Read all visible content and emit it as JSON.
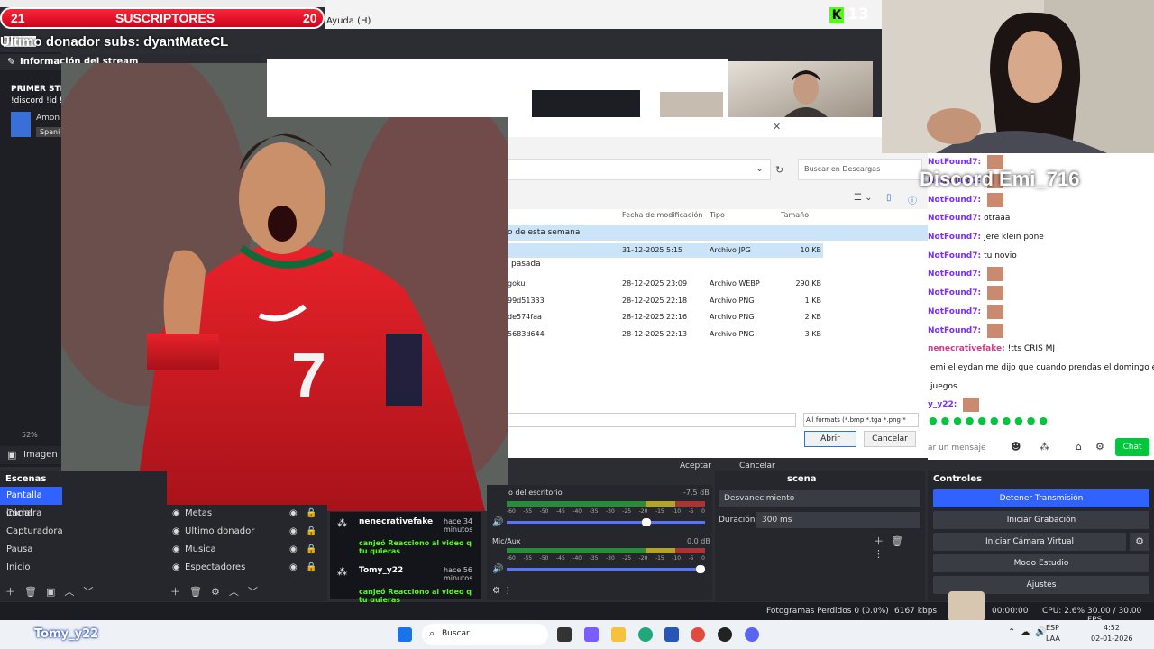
{
  "overlay": {
    "subs_left": "21",
    "subs_label": "SUSCRIPTORES",
    "subs_right": "20",
    "kick_count": "13",
    "donor_text": "Ultimo donador subs: dyantMateCL",
    "discord_text": "Discord Emi_716"
  },
  "obs": {
    "menu_help": "Ayuda (H)",
    "info_tab": "info",
    "stream_info_header": "Información del stream",
    "stream_title": "PRIMER STR",
    "stream_sub": "!discord !id !",
    "game": "Amon",
    "lang": "Spani",
    "zoom": "52%",
    "image_label": "Imagen",
    "scenes_header": "Escenas",
    "scenes": [
      "Pantalla inicial",
      "Camara",
      "Capturadora",
      "Pausa",
      "Inicio"
    ],
    "sources": [
      "Metas",
      "Ultimo donador",
      "Musica",
      "Espectadores"
    ],
    "events": [
      {
        "user": "nenecrativefake",
        "time": "hace 34 minutos",
        "text": "canjeó Reacciono al video q tu quieras"
      },
      {
        "user": "Tomy_y22",
        "time": "hace 56 minutos",
        "text": "canjeó Reacciono al video q tu quieras"
      }
    ],
    "mixer": {
      "track1": "o del escritorio",
      "track1_db": "-7.5 dB",
      "track2": "Mic/Aux",
      "track2_db": "0.0 dB",
      "ticks": [
        "-60",
        "-55",
        "-50",
        "-45",
        "-40",
        "-35",
        "-30",
        "-25",
        "-20",
        "-15",
        "-10",
        "-5",
        "0"
      ]
    },
    "transitions": {
      "header": "scena",
      "type": "Desvanecimiento",
      "duration_label": "Duración",
      "duration_value": "300 ms"
    },
    "controls": {
      "header": "Controles",
      "stop": "Detener Transmisión",
      "record": "Iniciar Grabación",
      "vcam": "Iniciar Cámara Virtual",
      "studio": "Modo Estudio",
      "settings": "Ajustes"
    },
    "status": {
      "dropped": "Fotogramas Perdidos 0 (0.0%)",
      "kbps": "6167 kbps",
      "rec": "00:00:00",
      "cpu": "CPU: 2.6%",
      "fps": "30.00 / 30.00 FPS"
    },
    "dialog_buttons": {
      "ok": "Aceptar",
      "cancel": "Cancelar"
    }
  },
  "file_dialog": {
    "search_placeholder": "Buscar en Descargas",
    "columns": [
      "Fecha de modificación",
      "Tipo",
      "Tamaño"
    ],
    "group1": "o de esta semana",
    "group2": "pasada",
    "rows": [
      {
        "name": "",
        "date": "31-12-2025 5:15",
        "type": "Archivo JPG",
        "size": "10 KB",
        "selected": true
      },
      {
        "name": "goku",
        "date": "28-12-2025 23:09",
        "type": "Archivo WEBP",
        "size": "290 KB",
        "selected": false
      },
      {
        "name": "99d51333",
        "date": "28-12-2025 22:18",
        "type": "Archivo PNG",
        "size": "1 KB",
        "selected": false
      },
      {
        "name": "de574faa",
        "date": "28-12-2025 22:16",
        "type": "Archivo PNG",
        "size": "2 KB",
        "selected": false
      },
      {
        "name": "5683d644",
        "date": "28-12-2025 22:13",
        "type": "Archivo PNG",
        "size": "3 KB",
        "selected": false
      }
    ],
    "filter": "All formats (*.bmp *.tga *.png *",
    "open": "Abrir",
    "cancel": "Cancelar"
  },
  "chat": {
    "lines": [
      {
        "user": "NotFound7:",
        "text": ""
      },
      {
        "user": "NotFound7:",
        "text": ""
      },
      {
        "user": "NotFound7:",
        "text": ""
      },
      {
        "user": "NotFound7:",
        "text": "otraaa"
      },
      {
        "user": "NotFound7:",
        "text": "jere klein pone"
      },
      {
        "user": "NotFound7:",
        "text": "tu novio"
      },
      {
        "user": "NotFound7:",
        "text": ""
      },
      {
        "user": "NotFound7:",
        "text": ""
      },
      {
        "user": "NotFound7:",
        "text": ""
      },
      {
        "user": "NotFound7:",
        "text": ""
      },
      {
        "user": "nenecrativefake:",
        "text": "!tts CRIS MJ"
      },
      {
        "user": "",
        "text": "emi el eydan me dijo que cuando prendas el domingo el"
      },
      {
        "user": "",
        "text": "juegos"
      },
      {
        "user": "y_y22:",
        "text": ""
      }
    ],
    "input_placeholder": "ar un mensaje",
    "chat_button": "Chat"
  },
  "taskbar": {
    "user_overlay": "Tomy_y22",
    "search": "Buscar",
    "lang": "ESP",
    "lang2": "LAA",
    "time": "4:52",
    "date": "02-01-2026"
  },
  "colors": {
    "accent": "#2f62ff",
    "kick": "#53fc18",
    "chat_btn": "#00c73c",
    "sub_red": "#e3001b"
  }
}
